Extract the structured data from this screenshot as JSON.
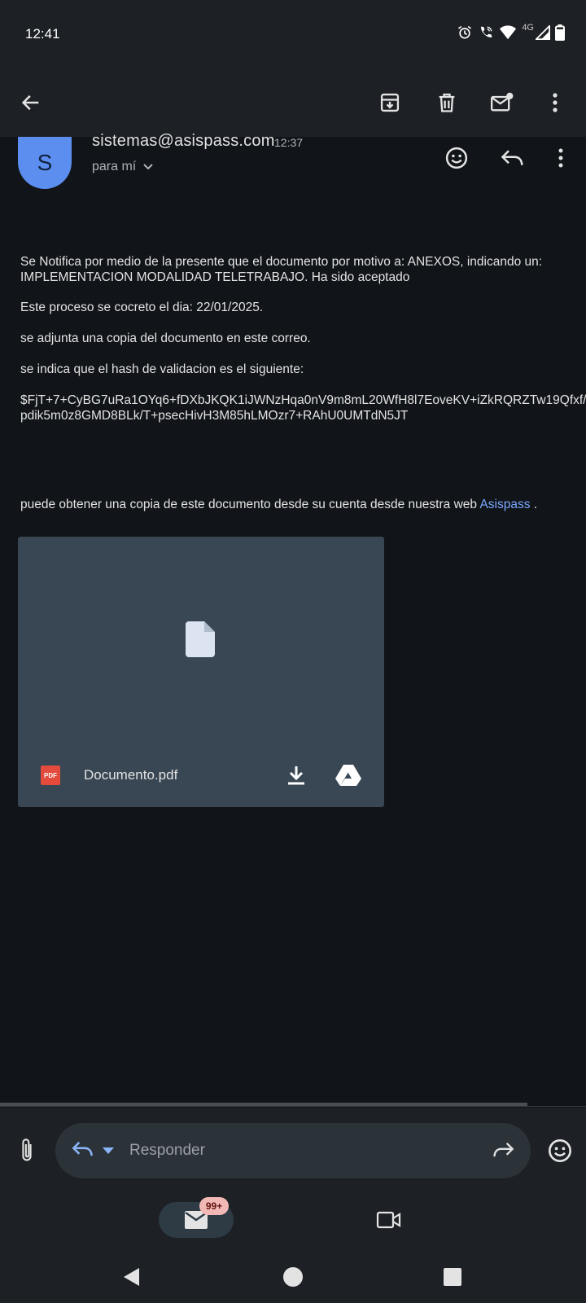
{
  "status_bar": {
    "time": "12:41",
    "network_label": "4G",
    "icons": [
      "alarm-icon",
      "wifi-calling-icon",
      "wifi-icon",
      "signal-icon",
      "battery-icon"
    ]
  },
  "toolbar": {
    "icons": [
      "back-arrow-icon",
      "archive-icon",
      "delete-icon",
      "mark-unread-icon",
      "more-vert-icon"
    ]
  },
  "message": {
    "avatar_letter": "S",
    "sender": "sistemas@asispass.com",
    "time": "12:37",
    "recipient": "para mí",
    "paragraphs": {
      "p1_line1": "Se Notifica por medio de la presente que el documento por motivo a: ANEXOS, indicando un:",
      "p1_line2": "IMPLEMENTACION MODALIDAD TELETRABAJO. Ha sido aceptado",
      "p2": "Este proceso se cocreto el dia: 22/01/2025.",
      "p3": "se adjunta una copia del documento en este correo.",
      "p4": "se indica que el hash de validacion es el siguiente:",
      "hash_line1": "$FjT+7+CyBG7uRa1OYq6+fDXbJKQK1iJWNzHqa0nV9m8mL20WfH8l7EoveKV+iZkRQRZTw19Qfxf/",
      "hash_line2": "pdik5m0z8GMD8BLk/T+psecHivH3M85hLMOzr7+RAhU0UMTdN5JT",
      "p5_text": "puede obtener una copia de este documento desde su cuenta desde nuestra web",
      "p5_link": "Asispass",
      "p5_end": " ."
    }
  },
  "attachment": {
    "file_name": "Documento.pdf",
    "type_badge": "PDF"
  },
  "reply_bar": {
    "placeholder": "Responder"
  },
  "bottom_nav": {
    "mail_badge": "99+"
  },
  "colors": {
    "background": "#111418",
    "surface": "#1d2024",
    "accent_blue": "#7aa7ff",
    "avatar_bg": "#5c8ef0",
    "attachment_bg": "#384753",
    "badge_bg": "#f2b8b5"
  }
}
